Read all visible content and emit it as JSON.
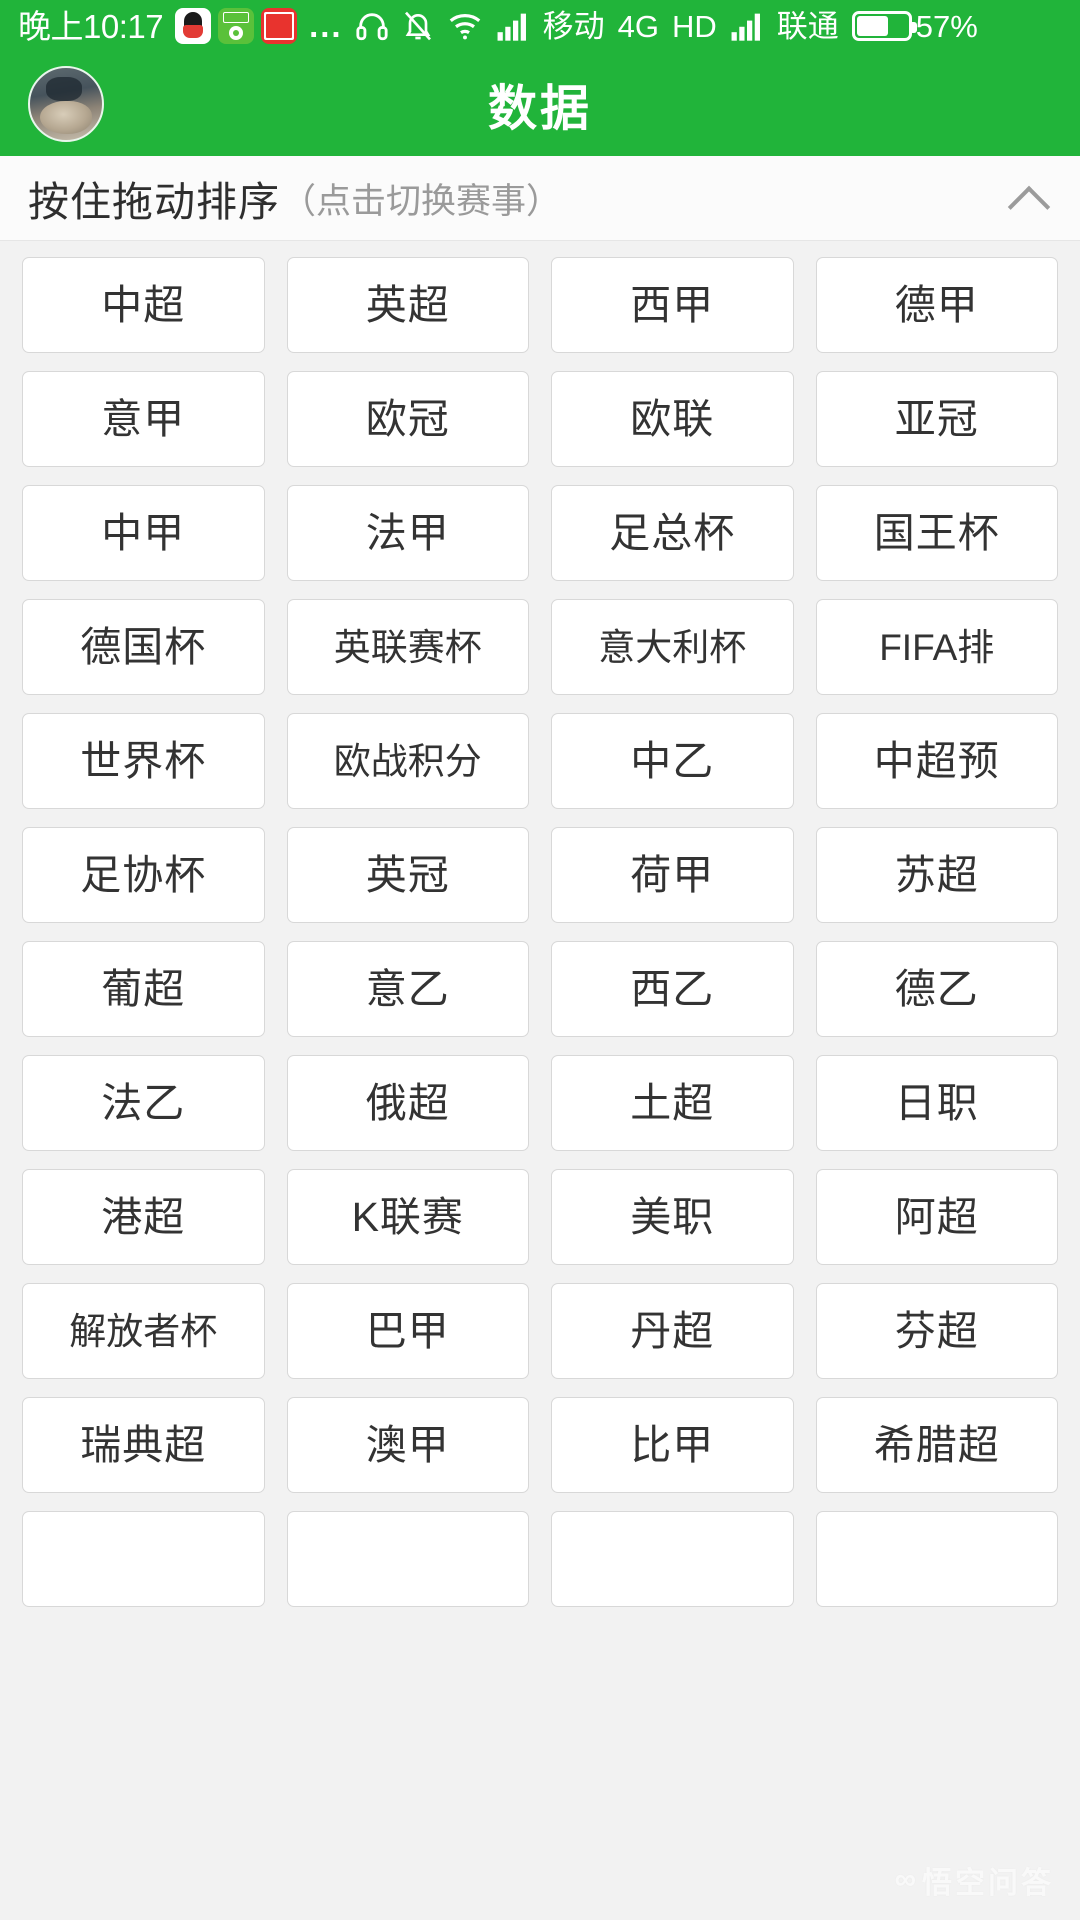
{
  "status_bar": {
    "time": "晚上10:17",
    "app_icons": [
      "qq-icon",
      "soccer-app-icon",
      "toutiao-icon"
    ],
    "overflow_dots": "...",
    "icons": [
      "headset-icon",
      "bell-muted-icon",
      "wifi-icon",
      "signal-bars-icon",
      "signal-bars-icon-2"
    ],
    "carrier_primary": "移动",
    "network_type": "4G",
    "hd_label": "HD",
    "carrier_secondary": "联通",
    "battery_percent": "57%",
    "battery_level": 57
  },
  "header": {
    "title": "数据",
    "avatar_name": "user-avatar"
  },
  "sort_bar": {
    "label": "按住拖动排序",
    "hint": "（点击切换赛事）",
    "collapse_icon": "chevron-up-icon"
  },
  "leagues": [
    "中超",
    "英超",
    "西甲",
    "德甲",
    "意甲",
    "欧冠",
    "欧联",
    "亚冠",
    "中甲",
    "法甲",
    "足总杯",
    "国王杯",
    "德国杯",
    "英联赛杯",
    "意大利杯",
    "FIFA排",
    "世界杯",
    "欧战积分",
    "中乙",
    "中超预",
    "足协杯",
    "英冠",
    "荷甲",
    "苏超",
    "葡超",
    "意乙",
    "西乙",
    "德乙",
    "法乙",
    "俄超",
    "土超",
    "日职",
    "港超",
    "K联赛",
    "美职",
    "阿超",
    "解放者杯",
    "巴甲",
    "丹超",
    "芬超",
    "瑞典超",
    "澳甲",
    "比甲",
    "希腊超",
    "",
    "",
    "",
    ""
  ],
  "watermark": {
    "glyph": "∞",
    "text": "悟空问答"
  },
  "colors": {
    "brand_green": "#21b43a",
    "page_bg": "#f2f2f2",
    "button_bg": "#ffffff",
    "button_border": "#d8d8d8",
    "text_primary": "#333333",
    "text_muted": "#9a9a9a"
  }
}
